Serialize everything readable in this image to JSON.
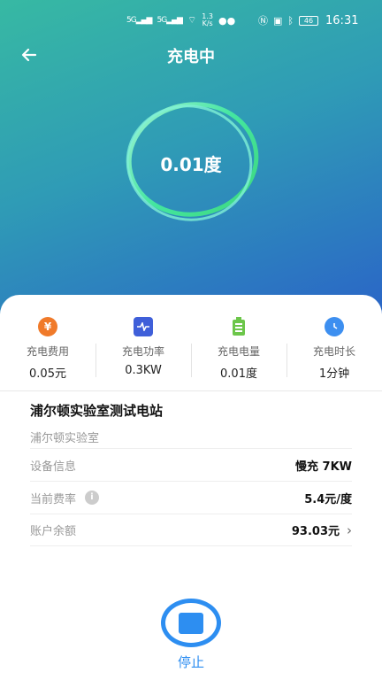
{
  "status_bar": {
    "sim1": "5G",
    "sim2": "5G",
    "net_speed_value": "1.3",
    "net_speed_unit": "K/s",
    "battery": "46",
    "time": "16:31"
  },
  "header": {
    "title": "充电中"
  },
  "ring": {
    "value": "0.01度"
  },
  "stats": [
    {
      "label": "充电费用",
      "value": "0.05元",
      "icon": "yuan-icon",
      "color": "#f07a2a"
    },
    {
      "label": "充电功率",
      "value": "0.3KW",
      "icon": "power-wave-icon",
      "color": "#3f5fd9"
    },
    {
      "label": "充电电量",
      "value": "0.01度",
      "icon": "battery-icon",
      "color": "#6cc64a"
    },
    {
      "label": "充电时长",
      "value": "1分钟",
      "icon": "clock-icon",
      "color": "#3d8ff0"
    }
  ],
  "station": {
    "name": "浦尔顿实验室测试电站",
    "subtitle": "浦尔顿实验室"
  },
  "details": {
    "device_label": "设备信息",
    "device_value": "慢充 7KW",
    "rate_label": "当前费率",
    "rate_value": "5.4元/度",
    "balance_label": "账户余额",
    "balance_value": "93.03元"
  },
  "stop": {
    "label": "停止"
  }
}
